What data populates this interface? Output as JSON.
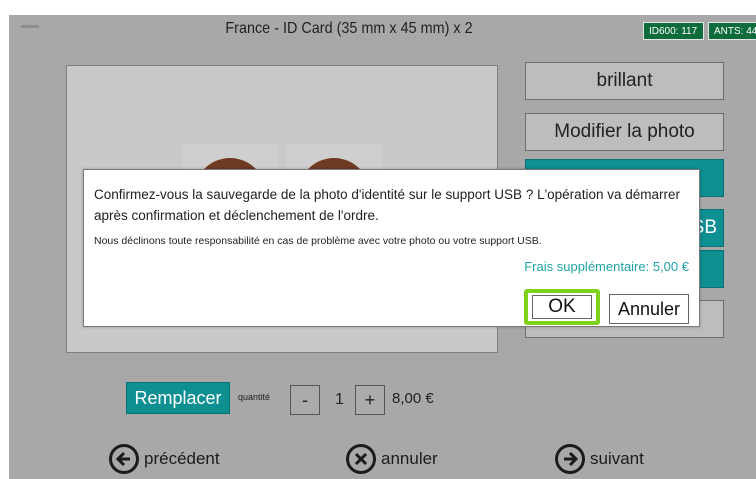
{
  "header": {
    "title": "France - ID Card (35 mm x 45 mm) x 2",
    "badges": [
      "ID600: 117",
      "ANTS: 44"
    ]
  },
  "side_buttons": [
    "brillant",
    "Modifier la photo",
    "",
    "SB",
    "",
    ""
  ],
  "bottom": {
    "replace_label": "Remplacer",
    "quantity_label": "quantité",
    "minus": "-",
    "quantity": "1",
    "plus": "+",
    "price": "8,00 €"
  },
  "nav": {
    "previous": "précédent",
    "cancel": "annuler",
    "next": "suivant"
  },
  "dialog": {
    "message_line1": "Confirmez-vous la sauvegarde de la photo d'identité sur le support USB ? L'opération va démarrer après confirmation et déclenchement de l'ordre.",
    "message_line2": "Nous déclinons toute responsabilité en cas de problème avec votre photo ou votre support USB.",
    "fee": "Frais supplémentaire: 5,00 €",
    "ok": "OK",
    "cancel": "Annuler"
  },
  "colors": {
    "teal": "#0e8f92",
    "badge_green": "#0e6b3b",
    "highlight": "#7fd11b",
    "fee_text": "#1fa3a8"
  }
}
